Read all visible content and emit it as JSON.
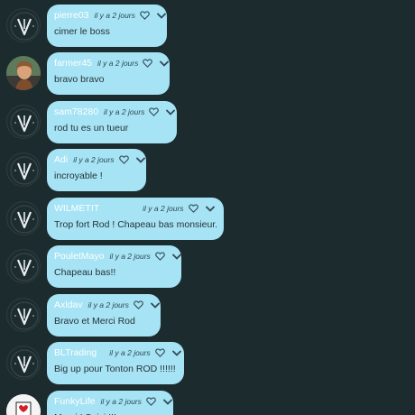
{
  "messages": [
    {
      "user": "pierre03",
      "time": "il y a 2 jours",
      "text": "cimer le boss",
      "avatar": "logo"
    },
    {
      "user": "farmer45",
      "time": "il y a 2 jours",
      "text": "bravo bravo",
      "avatar": "photo"
    },
    {
      "user": "sam78280",
      "time": "il y a 2 jours",
      "text": "rod tu es un tueur",
      "avatar": "logo"
    },
    {
      "user": "Adi",
      "time": "il y a 2 jours",
      "text": "incroyable !",
      "avatar": "logo"
    },
    {
      "user": "WILMETIT",
      "time": "il y a 2 jours",
      "text": "Trop fort Rod ! Chapeau bas monsieur.",
      "avatar": "logo"
    },
    {
      "user": "PouletMayo",
      "time": "il y a 2 jours",
      "text": "Chapeau bas!!",
      "avatar": "logo"
    },
    {
      "user": "Axldav",
      "time": "il y a 2 jours",
      "text": "Bravo et Merci Rod",
      "avatar": "logo"
    },
    {
      "user": "BLTrading",
      "time": "il y a 2 jours",
      "text": "Big up pour Tonton ROD !!!!!!",
      "avatar": "logo"
    },
    {
      "user": "FunkyLife",
      "time": "il y a 2 jours",
      "text": "Merci ! Suivi !!!",
      "avatar": "card"
    }
  ],
  "colors": {
    "bubble": "#a6e3f4",
    "background": "#1c2b2e",
    "username": "#ffffff"
  },
  "icons": {
    "like": "heart-outline-icon",
    "menu": "chevron-down-icon"
  }
}
